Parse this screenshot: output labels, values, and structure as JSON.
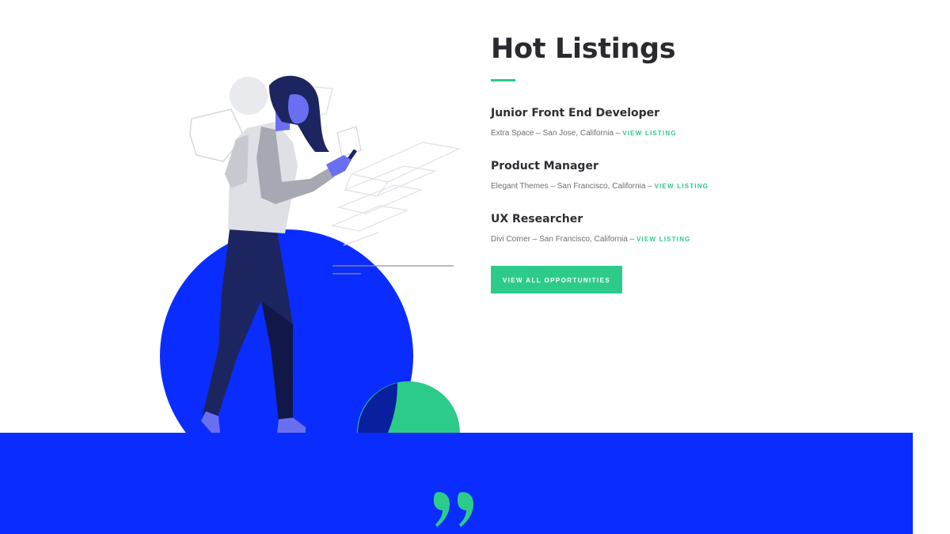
{
  "section": {
    "title": "Hot Listings"
  },
  "listings": [
    {
      "title": "Junior Front End Developer",
      "meta": "Extra Space – San Jose, California – ",
      "link_label": "VIEW LISTING"
    },
    {
      "title": "Product Manager",
      "meta": "Elegant Themes – San Francisco, California – ",
      "link_label": "VIEW LISTING"
    },
    {
      "title": "UX Researcher",
      "meta": "Divi Corner – San Francisco, California – ",
      "link_label": "VIEW LISTING"
    }
  ],
  "cta": {
    "label": "VIEW ALL OPPORTUNITIES"
  },
  "colors": {
    "accent_green": "#2dcb8a",
    "brand_blue": "#0b2cff",
    "heading_text": "#2a2a2f"
  },
  "icons": {
    "quote": "quote-icon"
  }
}
